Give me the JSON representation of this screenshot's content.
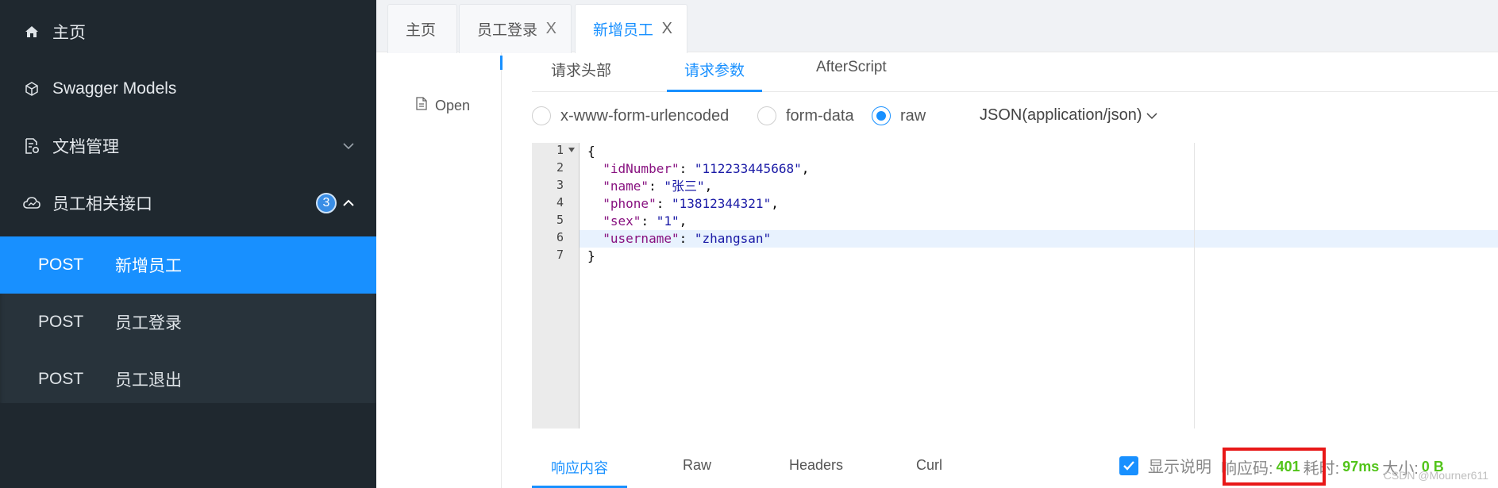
{
  "sidebar": {
    "items": [
      {
        "label": "主页",
        "icon": "home-icon"
      },
      {
        "label": "Swagger Models",
        "icon": "cube-icon"
      },
      {
        "label": "文档管理",
        "icon": "document-settings-icon"
      },
      {
        "label": "员工相关接口",
        "icon": "cloud-icon",
        "badge": "3"
      }
    ],
    "endpoints": [
      {
        "method": "POST",
        "name": "新增员工",
        "active": true
      },
      {
        "method": "POST",
        "name": "员工登录",
        "active": false
      },
      {
        "method": "POST",
        "name": "员工退出",
        "active": false
      }
    ]
  },
  "tabs": [
    {
      "label": "主页",
      "closable": false
    },
    {
      "label": "员工登录",
      "closable": true
    },
    {
      "label": "新增员工",
      "closable": true,
      "active": true
    }
  ],
  "close_glyph": "X",
  "left_pane": {
    "open_label": "Open"
  },
  "request": {
    "subtabs": [
      "请求头部",
      "请求参数",
      "AfterScript"
    ],
    "active_subtab": "请求参数",
    "body_types": [
      "x-www-form-urlencoded",
      "form-data",
      "raw"
    ],
    "selected_body_type": "raw",
    "content_type": "JSON(application/json)"
  },
  "editor": {
    "line_numbers": [
      "1",
      "2",
      "3",
      "4",
      "5",
      "6",
      "7"
    ],
    "lines": {
      "l1": "{",
      "l2_key": "\"idNumber\"",
      "l2_val": "\"112233445668\"",
      "l3_key": "\"name\"",
      "l3_val": "\"张三\"",
      "l4_key": "\"phone\"",
      "l4_val": "\"13812344321\"",
      "l5_key": "\"sex\"",
      "l5_val": "\"1\"",
      "l6_key": "\"username\"",
      "l6_val": "\"zhangsan\"",
      "l7": "}"
    }
  },
  "response": {
    "tabs": [
      "响应内容",
      "Raw",
      "Headers",
      "Curl"
    ],
    "show_desc_label": "显示说明",
    "status_label": "响应码:",
    "status_code": "401",
    "time_label": "耗时:",
    "time_value": "97ms",
    "size_label": "大小:",
    "size_value": "0 B"
  },
  "watermark": "CSDN @Mourner611",
  "colors": {
    "accent": "#1890ff",
    "sidebar_bg": "#1f282f",
    "success": "#52c41a",
    "highlight_box": "#e81818"
  }
}
